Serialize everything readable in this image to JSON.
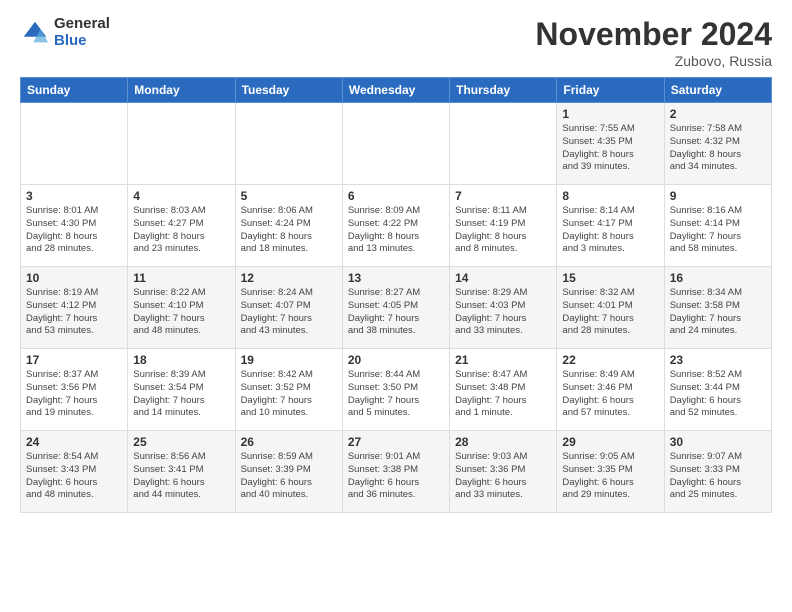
{
  "header": {
    "logo_general": "General",
    "logo_blue": "Blue",
    "month_title": "November 2024",
    "location": "Zubovo, Russia"
  },
  "days_of_week": [
    "Sunday",
    "Monday",
    "Tuesday",
    "Wednesday",
    "Thursday",
    "Friday",
    "Saturday"
  ],
  "weeks": [
    [
      {
        "day": "",
        "info": ""
      },
      {
        "day": "",
        "info": ""
      },
      {
        "day": "",
        "info": ""
      },
      {
        "day": "",
        "info": ""
      },
      {
        "day": "",
        "info": ""
      },
      {
        "day": "1",
        "info": "Sunrise: 7:55 AM\nSunset: 4:35 PM\nDaylight: 8 hours\nand 39 minutes."
      },
      {
        "day": "2",
        "info": "Sunrise: 7:58 AM\nSunset: 4:32 PM\nDaylight: 8 hours\nand 34 minutes."
      }
    ],
    [
      {
        "day": "3",
        "info": "Sunrise: 8:01 AM\nSunset: 4:30 PM\nDaylight: 8 hours\nand 28 minutes."
      },
      {
        "day": "4",
        "info": "Sunrise: 8:03 AM\nSunset: 4:27 PM\nDaylight: 8 hours\nand 23 minutes."
      },
      {
        "day": "5",
        "info": "Sunrise: 8:06 AM\nSunset: 4:24 PM\nDaylight: 8 hours\nand 18 minutes."
      },
      {
        "day": "6",
        "info": "Sunrise: 8:09 AM\nSunset: 4:22 PM\nDaylight: 8 hours\nand 13 minutes."
      },
      {
        "day": "7",
        "info": "Sunrise: 8:11 AM\nSunset: 4:19 PM\nDaylight: 8 hours\nand 8 minutes."
      },
      {
        "day": "8",
        "info": "Sunrise: 8:14 AM\nSunset: 4:17 PM\nDaylight: 8 hours\nand 3 minutes."
      },
      {
        "day": "9",
        "info": "Sunrise: 8:16 AM\nSunset: 4:14 PM\nDaylight: 7 hours\nand 58 minutes."
      }
    ],
    [
      {
        "day": "10",
        "info": "Sunrise: 8:19 AM\nSunset: 4:12 PM\nDaylight: 7 hours\nand 53 minutes."
      },
      {
        "day": "11",
        "info": "Sunrise: 8:22 AM\nSunset: 4:10 PM\nDaylight: 7 hours\nand 48 minutes."
      },
      {
        "day": "12",
        "info": "Sunrise: 8:24 AM\nSunset: 4:07 PM\nDaylight: 7 hours\nand 43 minutes."
      },
      {
        "day": "13",
        "info": "Sunrise: 8:27 AM\nSunset: 4:05 PM\nDaylight: 7 hours\nand 38 minutes."
      },
      {
        "day": "14",
        "info": "Sunrise: 8:29 AM\nSunset: 4:03 PM\nDaylight: 7 hours\nand 33 minutes."
      },
      {
        "day": "15",
        "info": "Sunrise: 8:32 AM\nSunset: 4:01 PM\nDaylight: 7 hours\nand 28 minutes."
      },
      {
        "day": "16",
        "info": "Sunrise: 8:34 AM\nSunset: 3:58 PM\nDaylight: 7 hours\nand 24 minutes."
      }
    ],
    [
      {
        "day": "17",
        "info": "Sunrise: 8:37 AM\nSunset: 3:56 PM\nDaylight: 7 hours\nand 19 minutes."
      },
      {
        "day": "18",
        "info": "Sunrise: 8:39 AM\nSunset: 3:54 PM\nDaylight: 7 hours\nand 14 minutes."
      },
      {
        "day": "19",
        "info": "Sunrise: 8:42 AM\nSunset: 3:52 PM\nDaylight: 7 hours\nand 10 minutes."
      },
      {
        "day": "20",
        "info": "Sunrise: 8:44 AM\nSunset: 3:50 PM\nDaylight: 7 hours\nand 5 minutes."
      },
      {
        "day": "21",
        "info": "Sunrise: 8:47 AM\nSunset: 3:48 PM\nDaylight: 7 hours\nand 1 minute."
      },
      {
        "day": "22",
        "info": "Sunrise: 8:49 AM\nSunset: 3:46 PM\nDaylight: 6 hours\nand 57 minutes."
      },
      {
        "day": "23",
        "info": "Sunrise: 8:52 AM\nSunset: 3:44 PM\nDaylight: 6 hours\nand 52 minutes."
      }
    ],
    [
      {
        "day": "24",
        "info": "Sunrise: 8:54 AM\nSunset: 3:43 PM\nDaylight: 6 hours\nand 48 minutes."
      },
      {
        "day": "25",
        "info": "Sunrise: 8:56 AM\nSunset: 3:41 PM\nDaylight: 6 hours\nand 44 minutes."
      },
      {
        "day": "26",
        "info": "Sunrise: 8:59 AM\nSunset: 3:39 PM\nDaylight: 6 hours\nand 40 minutes."
      },
      {
        "day": "27",
        "info": "Sunrise: 9:01 AM\nSunset: 3:38 PM\nDaylight: 6 hours\nand 36 minutes."
      },
      {
        "day": "28",
        "info": "Sunrise: 9:03 AM\nSunset: 3:36 PM\nDaylight: 6 hours\nand 33 minutes."
      },
      {
        "day": "29",
        "info": "Sunrise: 9:05 AM\nSunset: 3:35 PM\nDaylight: 6 hours\nand 29 minutes."
      },
      {
        "day": "30",
        "info": "Sunrise: 9:07 AM\nSunset: 3:33 PM\nDaylight: 6 hours\nand 25 minutes."
      }
    ]
  ]
}
